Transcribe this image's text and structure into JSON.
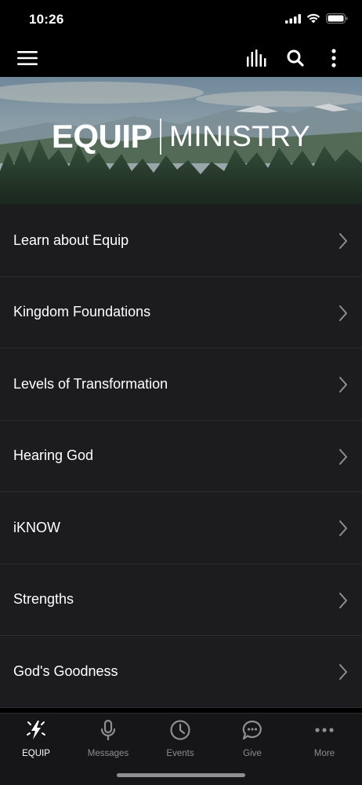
{
  "status_bar": {
    "time": "10:26"
  },
  "app_bar": {
    "menu_icon": "hamburger-menu-icon",
    "actions": [
      "bar-chart-icon",
      "search-icon",
      "more-vertical-icon"
    ]
  },
  "banner": {
    "title_bold": "EQUIP",
    "title_light": "MINISTRY"
  },
  "menu": {
    "items": [
      {
        "label": "Learn about Equip"
      },
      {
        "label": "Kingdom Foundations"
      },
      {
        "label": "Levels of Transformation"
      },
      {
        "label": "Hearing God"
      },
      {
        "label": "iKNOW"
      },
      {
        "label": "Strengths"
      },
      {
        "label": "God's Goodness"
      }
    ]
  },
  "tab_bar": {
    "active": "EQUIP",
    "tabs": [
      {
        "label": "EQUIP",
        "icon": "lightning-sparkle-icon"
      },
      {
        "label": "Messages",
        "icon": "microphone-icon"
      },
      {
        "label": "Events",
        "icon": "clock-icon"
      },
      {
        "label": "Give",
        "icon": "chat-bubble-icon"
      },
      {
        "label": "More",
        "icon": "more-horizontal-icon"
      }
    ]
  },
  "colors": {
    "background": "#000000",
    "list_background": "#1c1c1e",
    "divider": "#2c2c2e",
    "tab_inactive": "#8e8e93",
    "tab_active": "#ffffff"
  }
}
